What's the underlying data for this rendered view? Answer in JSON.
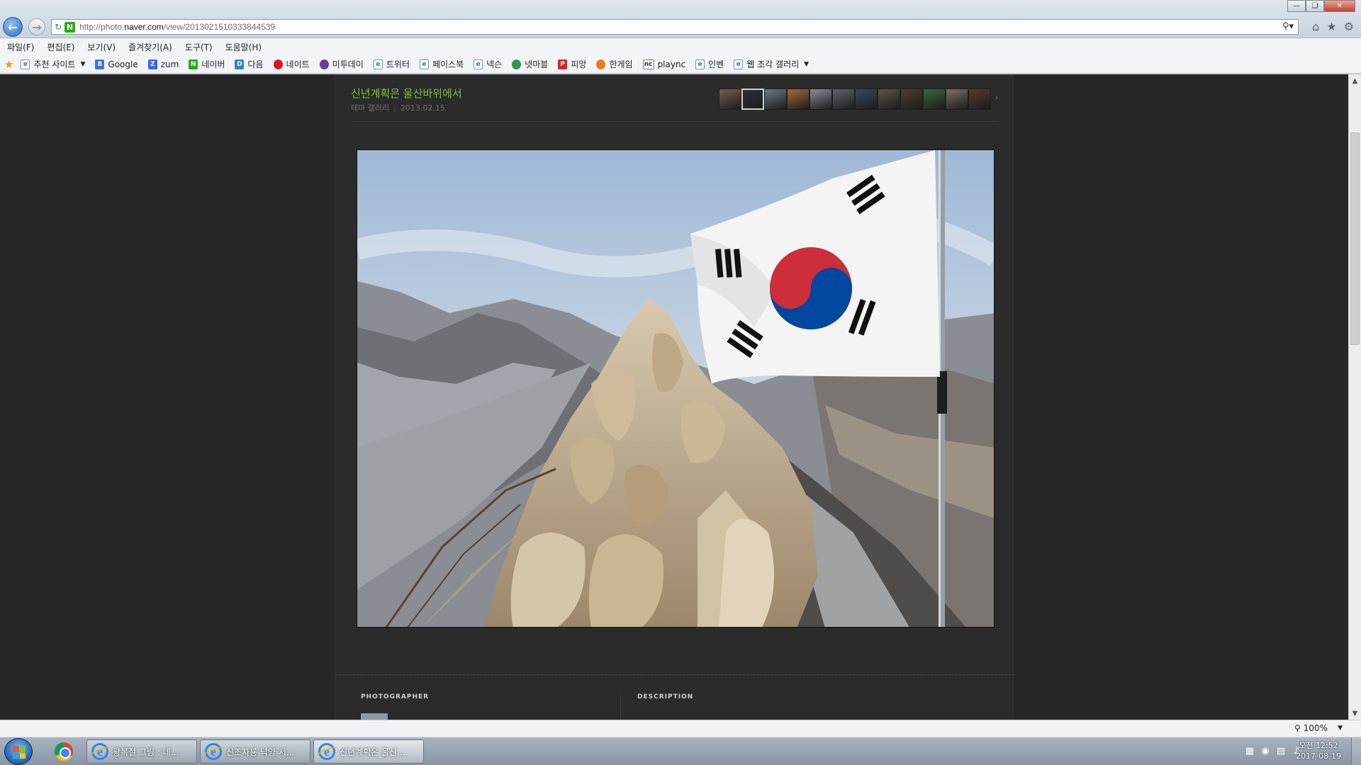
{
  "browser": {
    "url_prefix": "http://photo.",
    "url_domain": "naver.com",
    "url_path": "/view/2013021510333844539",
    "menu": [
      "파일(F)",
      "편집(E)",
      "보기(V)",
      "즐겨찾기(A)",
      "도구(T)",
      "도움말(H)"
    ],
    "favorites": [
      {
        "label": "추천 사이트",
        "icon": "page",
        "dropdown": true
      },
      {
        "label": "Google",
        "icon": "g"
      },
      {
        "label": "zum",
        "icon": "zum"
      },
      {
        "label": "네이버",
        "icon": "naver"
      },
      {
        "label": "다음",
        "icon": "daum"
      },
      {
        "label": "네이트",
        "icon": "nate"
      },
      {
        "label": "미투데이",
        "icon": "me2"
      },
      {
        "label": "트위터",
        "icon": "page"
      },
      {
        "label": "페이스북",
        "icon": "page"
      },
      {
        "label": "넥슨",
        "icon": "page"
      },
      {
        "label": "넷마블",
        "icon": "net"
      },
      {
        "label": "피망",
        "icon": "pi"
      },
      {
        "label": "한게임",
        "icon": "han"
      },
      {
        "label": "plaync",
        "icon": "nc"
      },
      {
        "label": "인벤",
        "icon": "page"
      },
      {
        "label": "웹 조각 갤러리",
        "icon": "page",
        "dropdown": true
      }
    ],
    "zoom": "100%"
  },
  "page": {
    "title": "신년계획은 울산바위에서",
    "category": "테마 갤러리",
    "date": "2013.02.15",
    "thumbnails": [
      "#7a5e4a",
      "#2c3038",
      "#6c7a86",
      "#a86a3c",
      "#8c8f92",
      "#5e6468",
      "#3c4a60",
      "#5a5648",
      "#4e4030",
      "#3c6a3a",
      "#7a7266",
      "#5a3a2a"
    ],
    "active_thumbnail": 1,
    "info_photographer_label": "PHOTOGRAPHER",
    "info_description_label": "DESCRIPTION"
  },
  "taskbar": {
    "items": [
      {
        "label": "광복절 그림 : 네..."
      },
      {
        "label": "신조자룡 낙양 서..."
      },
      {
        "label": "신년계획은 울산..."
      }
    ],
    "active_index": 2,
    "clock_time": "오전 12:52",
    "clock_date": "2017-08-19"
  },
  "colors": {
    "page_bg": "#262626",
    "title_green": "#7ec23a",
    "flag_red": "#cd2e3a",
    "flag_blue": "#0047a0"
  }
}
